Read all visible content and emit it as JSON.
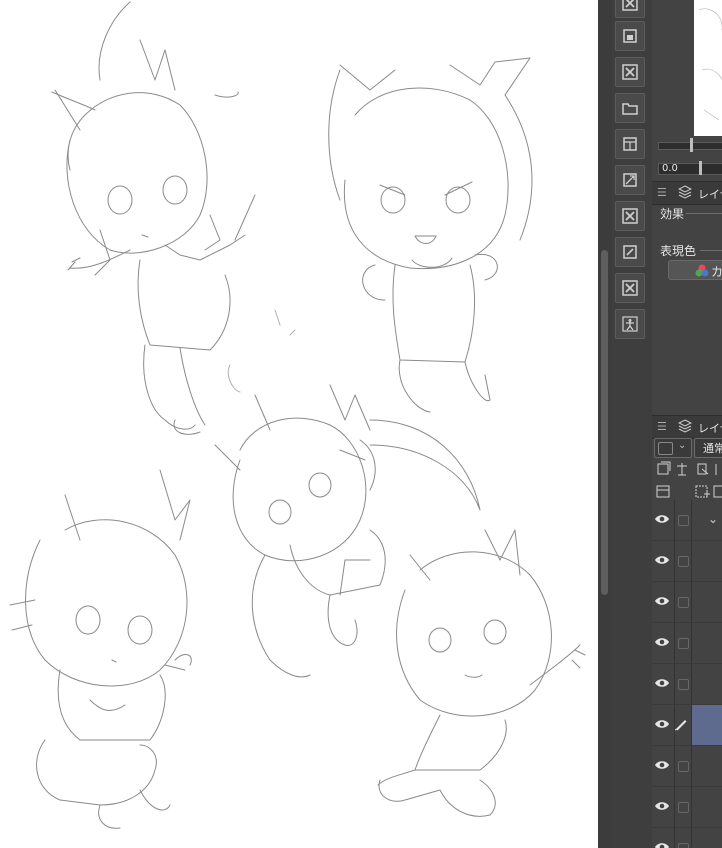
{
  "canvas": {
    "sketch_count": 5
  },
  "tool_buttons": [
    {
      "icon": "close-square-icon"
    },
    {
      "icon": "layer-save-icon"
    },
    {
      "icon": "close-square-icon"
    },
    {
      "icon": "folder-layer-icon"
    },
    {
      "icon": "new-layer-icon"
    },
    {
      "icon": "transform-icon"
    },
    {
      "icon": "close-square-icon"
    },
    {
      "icon": "edit-layer-icon"
    },
    {
      "icon": "close-square-icon"
    },
    {
      "icon": "pose-figure-icon"
    }
  ],
  "properties_panel": {
    "zoom_value": "0.0",
    "tab_label": "レイヤ",
    "effect_label": "効果",
    "expression_color_label": "表現色",
    "color_button_label": "カ"
  },
  "layer_panel": {
    "tab_label": "レイヤ",
    "blend_mode": "通常",
    "row_count": 9,
    "selected_row": 5
  },
  "colors": {
    "selected_layer": "#5f6a8f",
    "panel_bg": "#434343",
    "toolstrip_bg": "#3e3e3e"
  }
}
